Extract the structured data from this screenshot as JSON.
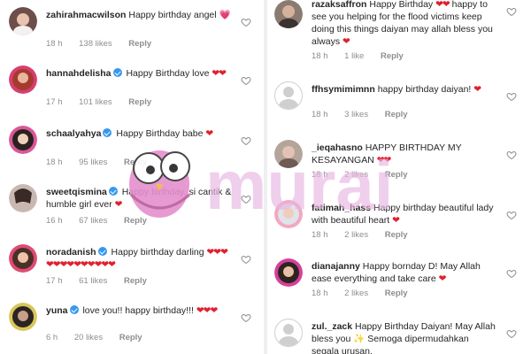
{
  "left_comments": [
    {
      "username": "zahirahmacwilson",
      "verified": false,
      "text": "Happy birthday angel",
      "emoji": "💗",
      "time": "18 h",
      "likes": "138 likes",
      "reply": "Reply"
    },
    {
      "username": "hannahdelisha",
      "verified": true,
      "text": "Happy Birthday love",
      "emoji": "❤❤",
      "time": "17 h",
      "likes": "101 likes",
      "reply": "Reply"
    },
    {
      "username": "schaalyahya",
      "verified": true,
      "text": "Happy Birthday babe",
      "emoji": "❤",
      "time": "18 h",
      "likes": "95 likes",
      "reply": "Reply"
    },
    {
      "username": "sweetqismina",
      "verified": true,
      "text": "Happy birthday, si cantik & humble girl ever",
      "emoji": "❤",
      "time": "16 h",
      "likes": "67 likes",
      "reply": "Reply"
    },
    {
      "username": "noradanish",
      "verified": true,
      "text": "Happy birthday darling",
      "emoji": "❤❤❤❤❤❤❤❤❤❤❤❤❤",
      "time": "17 h",
      "likes": "61 likes",
      "reply": "Reply"
    },
    {
      "username": "yuna",
      "verified": true,
      "text": "love you!! happy birthday!!!",
      "emoji": "❤❤❤",
      "time": "6 h",
      "likes": "20 likes",
      "reply": "Reply"
    }
  ],
  "right_comments": [
    {
      "username": "razaksaffron",
      "verified": false,
      "text": "Happy Birthday",
      "emoji": "❤❤",
      "text2": "happy to see you helping for the flood victims keep doing this things daiyan may allah bless you always",
      "emoji2": "❤",
      "time": "18 h",
      "likes": "1 like",
      "reply": "Reply"
    },
    {
      "username": "ffhsymimimnn",
      "verified": false,
      "text": "happy birthday daiyan!",
      "emoji": "❤",
      "time": "18 h",
      "likes": "3 likes",
      "reply": "Reply"
    },
    {
      "username": "_ieqahasno",
      "verified": false,
      "text": "HAPPY BIRTHDAY MY KESAYANGAN",
      "emoji": "❤❤",
      "time": "18 h",
      "likes": "2 likes",
      "reply": "Reply"
    },
    {
      "username": "fatimah_hass",
      "verified": false,
      "text": "Happy birthday beautiful lady with beautiful heart",
      "emoji": "❤",
      "time": "18 h",
      "likes": "2 likes",
      "reply": "Reply"
    },
    {
      "username": "dianajanny",
      "verified": false,
      "text": "Happy bornday D! May Allah ease everything and take care",
      "emoji": "❤",
      "time": "18 h",
      "likes": "2 likes",
      "reply": "Reply"
    },
    {
      "username": "zul._zack",
      "verified": false,
      "text": "Happy Birthday Daiyan! May Allah bless you",
      "emoji": "✨",
      "text2": "Semoga dipermudahkan segala urusan.",
      "emoji2": "",
      "time": "",
      "likes": "",
      "reply": ""
    }
  ],
  "watermark": {
    "text": "murai",
    "color": "#e7b6e3"
  },
  "colors": {
    "heart": "#e0202e",
    "verified": "#3897f0",
    "meta": "#8e8e8e"
  }
}
